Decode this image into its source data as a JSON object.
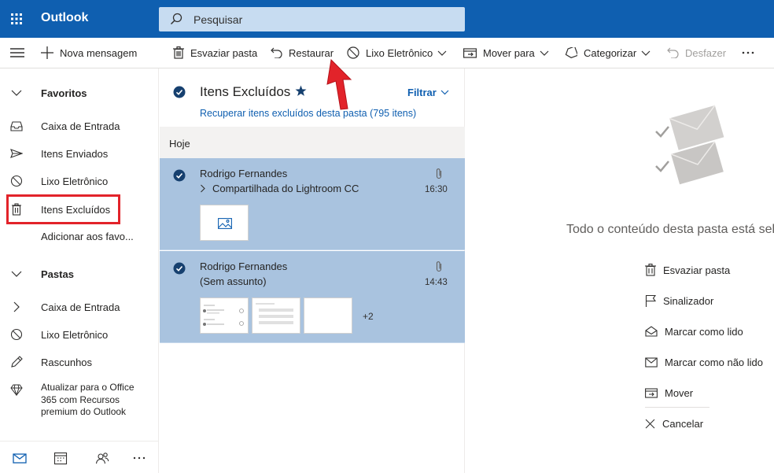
{
  "topbar": {
    "app_name": "Outlook",
    "search_placeholder": "Pesquisar",
    "icons": {
      "launcher": "waffle-icon",
      "search": "search-icon"
    },
    "bar_color": "#0f5fb0"
  },
  "commandbar": {
    "new_message": "Nova mensagem",
    "empty_folder": "Esvaziar pasta",
    "restore": "Restaurar",
    "junk": "Lixo Eletrônico",
    "move_to": "Mover para",
    "categorize": "Categorizar",
    "undo": "Desfazer"
  },
  "sidebar": {
    "favorites_header": "Favoritos",
    "favorites": [
      {
        "label": "Caixa de Entrada",
        "icon": "inbox-icon"
      },
      {
        "label": "Itens Enviados",
        "icon": "send-icon"
      },
      {
        "label": "Lixo Eletrônico",
        "icon": "block-icon"
      },
      {
        "label": "Itens Excluídos",
        "icon": "trash-icon"
      }
    ],
    "add_favorites": "Adicionar aos favo...",
    "folders_header": "Pastas",
    "folders": [
      {
        "label": "Caixa de Entrada",
        "icon": "chevron-right-icon"
      },
      {
        "label": "Lixo Eletrônico",
        "icon": "block-icon"
      },
      {
        "label": "Rascunhos",
        "icon": "pencil-icon"
      }
    ],
    "upgrade_text": "Atualizar para o Office 365 com Recursos premium do Outlook",
    "highlight_color": "#e2232a"
  },
  "messagelist": {
    "folder_title": "Itens Excluídos",
    "filter_label": "Filtrar",
    "recover_link": "Recuperar itens excluídos desta pasta (795 itens)",
    "group_label": "Hoje",
    "selected_color": "#a9c3df",
    "messages": [
      {
        "sender": "Rodrigo Fernandes",
        "subject": "Compartilhada do Lightroom CC",
        "time": "16:30",
        "has_attachment": true
      },
      {
        "sender": "Rodrigo Fernandes",
        "subject": "(Sem assunto)",
        "time": "14:43",
        "has_attachment": true,
        "more_attachments": "+2"
      }
    ]
  },
  "readingpane": {
    "all_selected_text": "Todo o conteúdo desta pasta está sele",
    "actions": [
      {
        "label": "Esvaziar pasta",
        "icon": "trash-icon"
      },
      {
        "label": "Sinalizador",
        "icon": "flag-icon"
      },
      {
        "label": "Marcar como lido",
        "icon": "open-envelope-icon"
      },
      {
        "label": "Marcar como não lido",
        "icon": "envelope-icon"
      },
      {
        "label": "Mover",
        "icon": "move-icon"
      },
      {
        "label": "Cancelar",
        "icon": "close-icon"
      }
    ]
  },
  "annotation": {
    "arrow_color": "#e2232a",
    "points_to": "Restaurar"
  }
}
